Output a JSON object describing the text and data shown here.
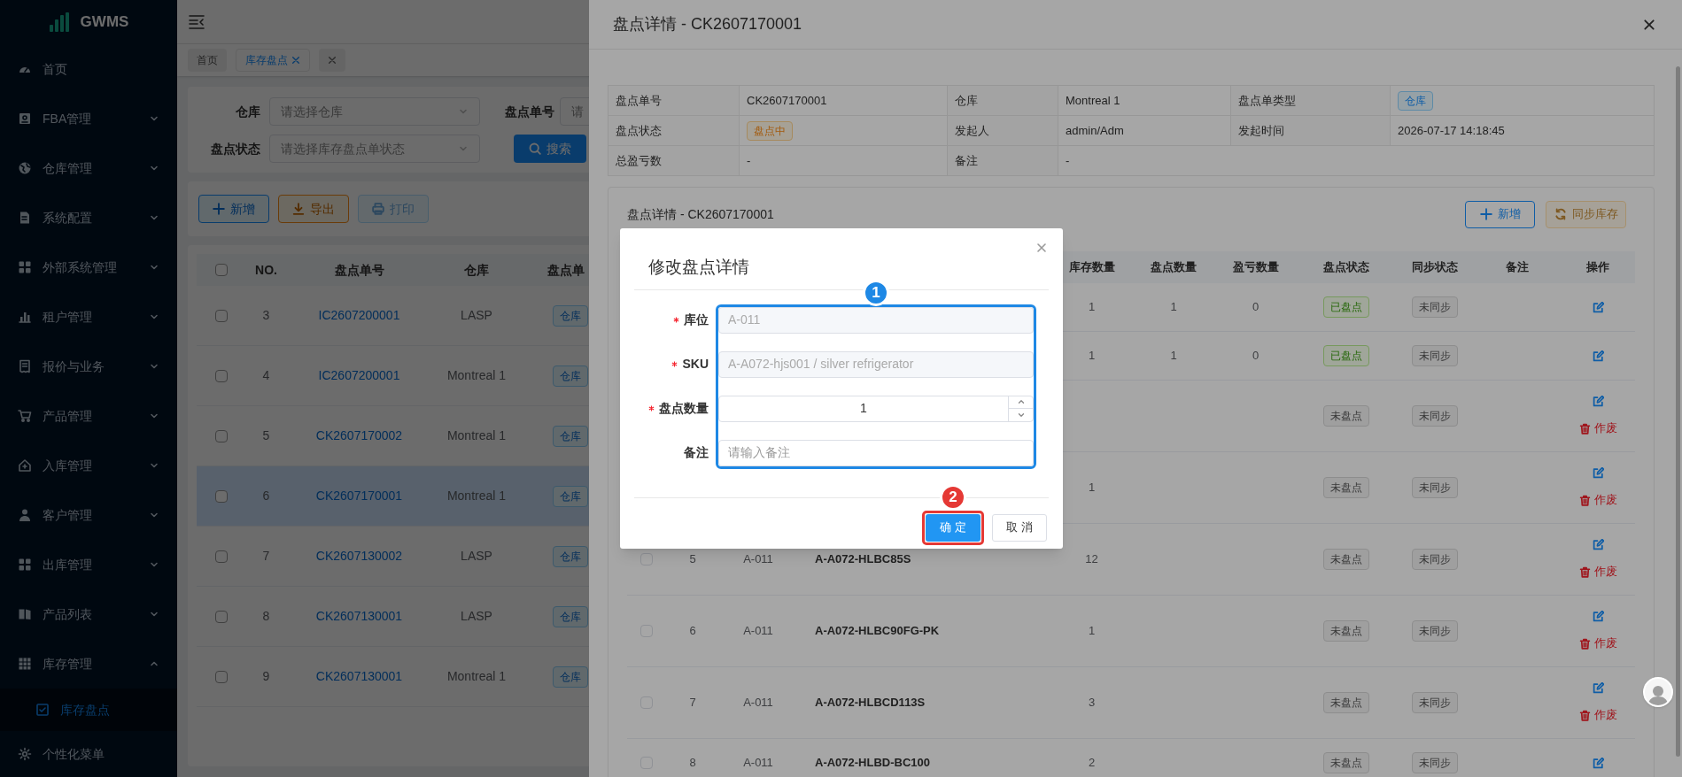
{
  "sidebar": {
    "logo": "GWMS",
    "items": [
      {
        "label": "首页"
      },
      {
        "label": "FBA管理",
        "expanded": false
      },
      {
        "label": "仓库管理",
        "expanded": false
      },
      {
        "label": "系统配置",
        "expanded": false
      },
      {
        "label": "外部系统管理",
        "expanded": false
      },
      {
        "label": "租户管理",
        "expanded": false
      },
      {
        "label": "报价与业务",
        "expanded": false
      },
      {
        "label": "产品管理",
        "expanded": false
      },
      {
        "label": "入库管理",
        "expanded": false
      },
      {
        "label": "客户管理",
        "expanded": false
      },
      {
        "label": "出库管理",
        "expanded": false
      },
      {
        "label": "产品列表",
        "expanded": false
      },
      {
        "label": "库存管理",
        "expanded": true,
        "children": [
          {
            "label": "库存盘点",
            "selected": true
          }
        ]
      },
      {
        "label": "个性化菜单"
      }
    ]
  },
  "tabs": [
    {
      "label": "首页",
      "selected": false,
      "closable": false
    },
    {
      "label": "库存盘点",
      "selected": true,
      "closable": true
    }
  ],
  "filters": [
    {
      "label": "仓库",
      "placeholder": "请选择仓库",
      "kind": "select"
    },
    {
      "label": "盘点单号",
      "placeholder": "请",
      "kind": "text"
    },
    {
      "label": "盘点状态",
      "placeholder": "请选择库存盘点单状态",
      "kind": "select"
    }
  ],
  "search_button": "搜索",
  "toolbar": [
    {
      "label": "新增",
      "kind": "add",
      "disabled": false
    },
    {
      "label": "导出",
      "kind": "export",
      "disabled": false
    },
    {
      "label": "打印",
      "kind": "print",
      "disabled": true
    }
  ],
  "table": {
    "all_checked": false,
    "columns": [
      "NO.",
      "盘点单号",
      "仓库",
      "盘点单"
    ],
    "rows": [
      {
        "checked": false,
        "no": "3",
        "code": "IC2607200001",
        "warehouse": "LASP",
        "type": "仓库",
        "selected": false
      },
      {
        "checked": false,
        "no": "4",
        "code": "IC2607200001",
        "warehouse": "Montreal 1",
        "type": "仓库",
        "selected": false
      },
      {
        "checked": false,
        "no": "5",
        "code": "CK2607170002",
        "warehouse": "Montreal 1",
        "type": "仓库",
        "selected": false
      },
      {
        "checked": false,
        "no": "6",
        "code": "CK2607170001",
        "warehouse": "Montreal 1",
        "type": "仓库",
        "selected": true
      },
      {
        "checked": false,
        "no": "7",
        "code": "CK2607130002",
        "warehouse": "LASP",
        "type": "仓库",
        "selected": false
      },
      {
        "checked": false,
        "no": "8",
        "code": "CK2607130001",
        "warehouse": "LASP",
        "type": "仓库",
        "selected": false
      },
      {
        "checked": false,
        "no": "9",
        "code": "CK2607130001",
        "warehouse": "Montreal 1",
        "type": "仓库",
        "selected": false
      }
    ]
  },
  "drawer": {
    "title": "盘点详情 - CK2607170001",
    "details": [
      {
        "label": "盘点单号",
        "value": "CK2607170001"
      },
      {
        "label": "仓库",
        "value": "Montreal 1"
      },
      {
        "label": "盘点单类型",
        "value": "仓库",
        "kind": "primary"
      },
      {
        "label": "盘点状态",
        "value": "盘点中",
        "kind": "warning"
      },
      {
        "label": "发起人",
        "value": "admin/Adm"
      },
      {
        "label": "发起时间",
        "value": "2026-07-17 14:18:45"
      },
      {
        "label": "总盈亏数",
        "value": "-"
      },
      {
        "label": "备注",
        "value": "-"
      }
    ],
    "card": {
      "title": "盘点详情 - CK2607170001",
      "buttons": [
        {
          "label": "新增",
          "kind": "add",
          "disabled": false
        },
        {
          "label": "同步库存",
          "kind": "sync",
          "disabled": true
        }
      ],
      "columns": [
        "库存数量",
        "盘点数量",
        "盈亏数量",
        "盘点状态",
        "同步状态",
        "备注",
        "操作"
      ],
      "rows": [
        {
          "stock": "1",
          "counted": "1",
          "diff": "0",
          "count_status": {
            "label": "已盘点",
            "kind": "success"
          },
          "sync_status": {
            "label": "未同步",
            "kind": "info"
          },
          "actions": [
            {
              "kind": "edit"
            }
          ]
        },
        {
          "stock": "1",
          "counted": "1",
          "diff": "0",
          "count_status": {
            "label": "已盘点",
            "kind": "success"
          },
          "sync_status": {
            "label": "未同步",
            "kind": "info"
          },
          "actions": [
            {
              "kind": "edit"
            }
          ]
        },
        {
          "count_status": {
            "label": "未盘点",
            "kind": "info"
          },
          "sync_status": {
            "label": "未同步",
            "kind": "info"
          },
          "actions": [
            {
              "kind": "edit"
            },
            {
              "kind": "void",
              "label": "作废"
            }
          ]
        },
        {
          "stock": "1",
          "count_status": {
            "label": "未盘点",
            "kind": "info"
          },
          "sync_status": {
            "label": "未同步",
            "kind": "info"
          },
          "actions": [
            {
              "kind": "edit"
            },
            {
              "kind": "void",
              "label": "作废"
            }
          ]
        },
        {
          "checked": false,
          "no": "5",
          "location": "A-011",
          "sku": "A-A072-HLBC85S",
          "stock": "12",
          "count_status": {
            "label": "未盘点",
            "kind": "info"
          },
          "sync_status": {
            "label": "未同步",
            "kind": "info"
          },
          "actions": [
            {
              "kind": "edit"
            },
            {
              "kind": "void",
              "label": "作废"
            }
          ]
        },
        {
          "checked": false,
          "no": "6",
          "location": "A-011",
          "sku": "A-A072-HLBC90FG-PK",
          "stock": "1",
          "count_status": {
            "label": "未盘点",
            "kind": "info"
          },
          "sync_status": {
            "label": "未同步",
            "kind": "info"
          },
          "actions": [
            {
              "kind": "edit"
            },
            {
              "kind": "void",
              "label": "作废"
            }
          ]
        },
        {
          "checked": false,
          "no": "7",
          "location": "A-011",
          "sku": "A-A072-HLBCD113S",
          "stock": "3",
          "count_status": {
            "label": "未盘点",
            "kind": "info"
          },
          "sync_status": {
            "label": "未同步",
            "kind": "info"
          },
          "actions": [
            {
              "kind": "edit"
            },
            {
              "kind": "void",
              "label": "作废"
            }
          ]
        },
        {
          "checked": false,
          "no": "8",
          "location": "A-011",
          "sku": "A-A072-HLBD-BC100",
          "stock": "2",
          "count_status": {
            "label": "未盘点",
            "kind": "info"
          },
          "sync_status": {
            "label": "未同步",
            "kind": "info"
          },
          "actions": [
            {
              "kind": "edit"
            }
          ]
        }
      ]
    }
  },
  "modal": {
    "title": "修改盘点详情",
    "fields": [
      {
        "label": "库位",
        "required": true,
        "kind": "text",
        "value": "A-011",
        "disabled": true
      },
      {
        "label": "SKU",
        "required": true,
        "kind": "text",
        "value": "A-A072-hjs001 / silver refrigerator",
        "disabled": true
      },
      {
        "label": "盘点数量",
        "required": true,
        "kind": "number",
        "value": "1",
        "disabled": false
      },
      {
        "label": "备注",
        "required": false,
        "kind": "text",
        "placeholder": "请输入备注",
        "disabled": false
      }
    ],
    "buttons": [
      {
        "label": "确 定",
        "kind": "primary"
      },
      {
        "label": "取 消",
        "kind": "default"
      }
    ],
    "callouts": [
      {
        "label": "1",
        "color": "#1e88e5"
      },
      {
        "label": "2",
        "color": "#e53935"
      }
    ]
  }
}
